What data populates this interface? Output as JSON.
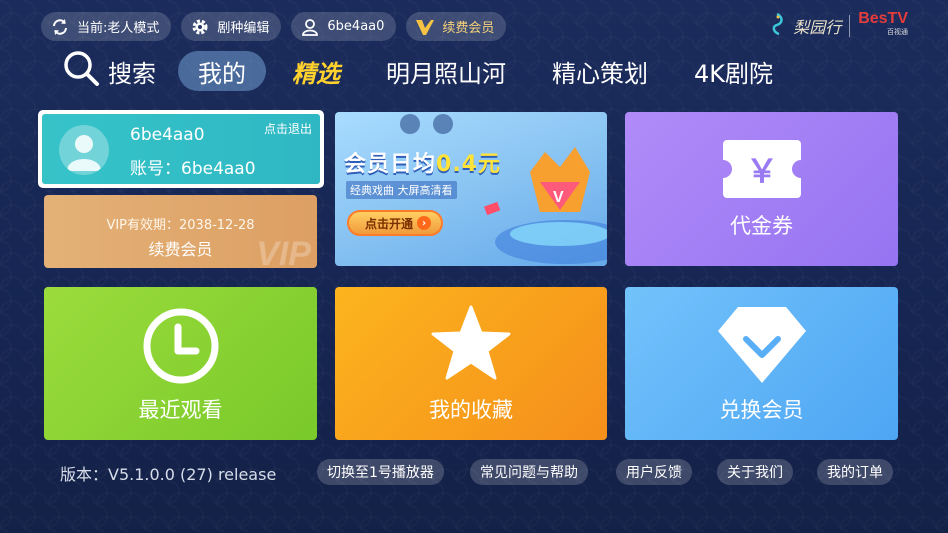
{
  "topbar": {
    "mode_label": "当前:老人模式",
    "edit_label": "剧种编辑",
    "user_label": "6be4aa0",
    "vip_label": "续费会员"
  },
  "brand": {
    "name": "梨园行",
    "partner": "BesTV",
    "partner_sub": "百视通"
  },
  "nav": {
    "search_label": "搜索",
    "tabs": [
      {
        "label": "我的",
        "state": "active"
      },
      {
        "label": "精选",
        "state": "featured"
      },
      {
        "label": "明月照山河"
      },
      {
        "label": "精心策划"
      },
      {
        "label": "4K剧院"
      }
    ]
  },
  "account": {
    "username": "6be4aa0",
    "account_line": "账号：6be4aa0",
    "logout_label": "点击退出"
  },
  "vip_card": {
    "expiry": "VIP有效期：2038-12-28",
    "action": "续费会员",
    "watermark": "VIP"
  },
  "banner": {
    "headline_prefix": "会员日均",
    "headline_value": "0.4元",
    "subline": "经典戏曲 大屏高清看",
    "button_label": "点击开通"
  },
  "tiles": {
    "coupon": {
      "label": "代金券",
      "symbol": "￥"
    },
    "recent": {
      "label": "最近观看"
    },
    "favorites": {
      "label": "我的收藏"
    },
    "redeem": {
      "label": "兑换会员"
    }
  },
  "footer": {
    "version": "版本：V5.1.0.0 (27) release",
    "buttons": [
      {
        "label": "切换至1号播放器"
      },
      {
        "label": "常见问题与帮助"
      },
      {
        "label": "用户反馈"
      },
      {
        "label": "关于我们"
      },
      {
        "label": "我的订单"
      }
    ]
  },
  "colors": {
    "background": "#1b2c5c",
    "featured_tab": "#ffd12e",
    "account_card": "#36c3c8",
    "vip_card": "#e3b177",
    "coupon_tile": "#a080f6",
    "recent_tile": "#8bd436",
    "favorites_tile": "#f9a21d",
    "redeem_tile": "#62b6f7"
  }
}
